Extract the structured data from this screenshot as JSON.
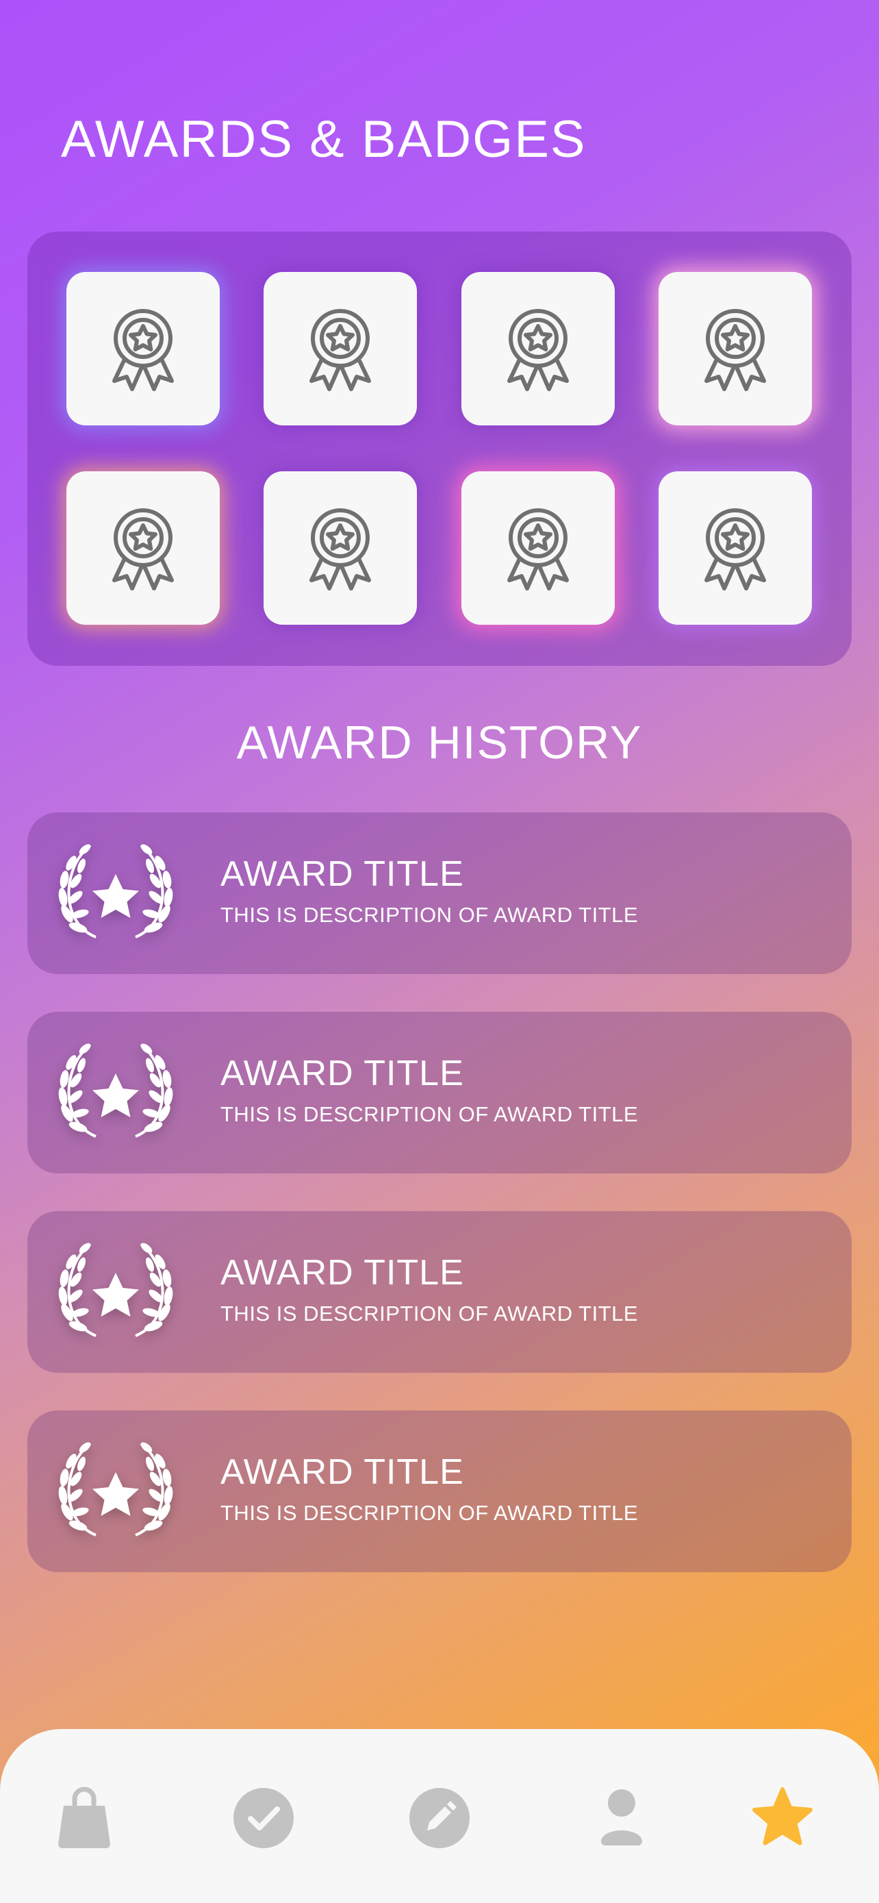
{
  "header": {
    "title": "AWARDS & BADGES"
  },
  "badges": [
    {
      "icon": "award-ribbon-icon"
    },
    {
      "icon": "award-ribbon-icon"
    },
    {
      "icon": "award-ribbon-icon"
    },
    {
      "icon": "award-ribbon-icon"
    },
    {
      "icon": "award-ribbon-icon"
    },
    {
      "icon": "award-ribbon-icon"
    },
    {
      "icon": "award-ribbon-icon"
    },
    {
      "icon": "award-ribbon-icon"
    }
  ],
  "history": {
    "title": "AWARD HISTORY",
    "items": [
      {
        "title": "AWARD TITLE",
        "description": "THIS IS DESCRIPTION OF AWARD TITLE",
        "icon": "laurel-star-icon"
      },
      {
        "title": "AWARD TITLE",
        "description": "THIS IS DESCRIPTION OF AWARD TITLE",
        "icon": "laurel-star-icon"
      },
      {
        "title": "AWARD TITLE",
        "description": "THIS IS DESCRIPTION OF AWARD TITLE",
        "icon": "laurel-star-icon"
      },
      {
        "title": "AWARD TITLE",
        "description": "THIS IS DESCRIPTION OF AWARD TITLE",
        "icon": "laurel-star-icon"
      }
    ]
  },
  "tabbar": {
    "items": [
      {
        "icon": "shopping-bag-icon",
        "active": false
      },
      {
        "icon": "check-circle-icon",
        "active": false
      },
      {
        "icon": "pencil-circle-icon",
        "active": false
      },
      {
        "icon": "user-icon",
        "active": false
      },
      {
        "icon": "star-icon",
        "active": true
      }
    ],
    "active_color": "#fcb935",
    "inactive_color": "#c2c2c2"
  },
  "colors": {
    "gradient_start": "#ad52fb",
    "gradient_end": "#ffaa22",
    "badge_tile": "#f7f7f7",
    "badge_icon": "#6e6e6e"
  }
}
